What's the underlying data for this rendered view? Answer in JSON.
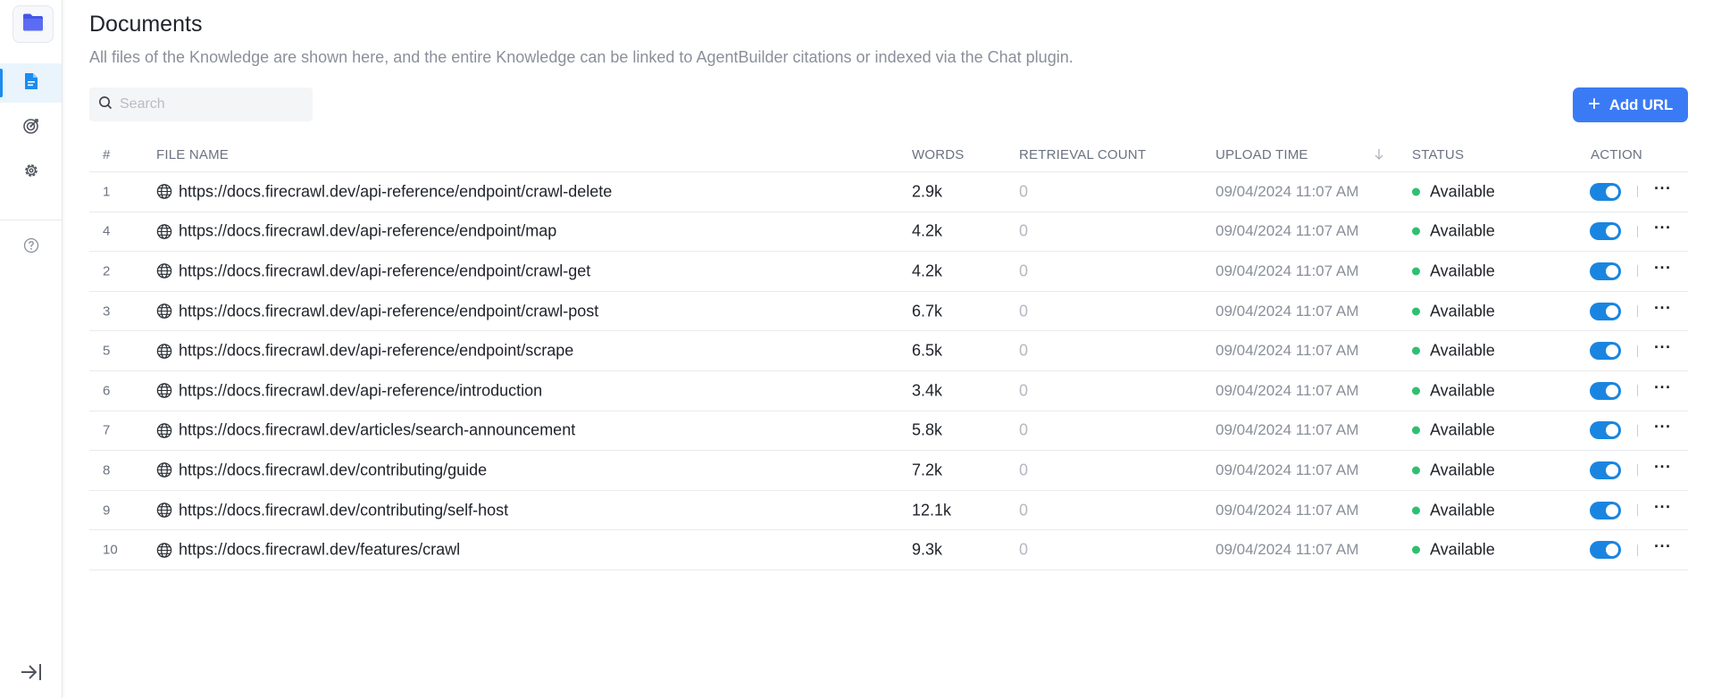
{
  "page": {
    "title": "Documents",
    "description": "All files of the Knowledge are shown here, and the entire Knowledge can be linked to AgentBuilder citations or indexed via the Chat plugin."
  },
  "search": {
    "placeholder": "Search"
  },
  "add_button": {
    "label": "Add URL"
  },
  "colors": {
    "accent": "#3a7bf5",
    "toggle_on": "#1a85e0",
    "status_available": "#2fbf71",
    "active_nav_bg": "#e9f4fd"
  },
  "sidebar": {
    "icons": [
      "folder-icon",
      "document-icon",
      "target-icon",
      "gear-icon",
      "help-icon",
      "collapse-icon"
    ]
  },
  "table": {
    "headers": {
      "num": "#",
      "file_name": "FILE NAME",
      "words": "WORDS",
      "retrieval_count": "RETRIEVAL COUNT",
      "upload_time": "UPLOAD TIME",
      "status": "STATUS",
      "action": "ACTION"
    },
    "rows": [
      {
        "num": "1",
        "file": "https://docs.firecrawl.dev/api-reference/endpoint/crawl-delete",
        "words": "2.9k",
        "retrieval": "0",
        "time": "09/04/2024 11:07 AM",
        "status": "Available",
        "enabled": true
      },
      {
        "num": "4",
        "file": "https://docs.firecrawl.dev/api-reference/endpoint/map",
        "words": "4.2k",
        "retrieval": "0",
        "time": "09/04/2024 11:07 AM",
        "status": "Available",
        "enabled": true
      },
      {
        "num": "2",
        "file": "https://docs.firecrawl.dev/api-reference/endpoint/crawl-get",
        "words": "4.2k",
        "retrieval": "0",
        "time": "09/04/2024 11:07 AM",
        "status": "Available",
        "enabled": true
      },
      {
        "num": "3",
        "file": "https://docs.firecrawl.dev/api-reference/endpoint/crawl-post",
        "words": "6.7k",
        "retrieval": "0",
        "time": "09/04/2024 11:07 AM",
        "status": "Available",
        "enabled": true
      },
      {
        "num": "5",
        "file": "https://docs.firecrawl.dev/api-reference/endpoint/scrape",
        "words": "6.5k",
        "retrieval": "0",
        "time": "09/04/2024 11:07 AM",
        "status": "Available",
        "enabled": true
      },
      {
        "num": "6",
        "file": "https://docs.firecrawl.dev/api-reference/introduction",
        "words": "3.4k",
        "retrieval": "0",
        "time": "09/04/2024 11:07 AM",
        "status": "Available",
        "enabled": true
      },
      {
        "num": "7",
        "file": "https://docs.firecrawl.dev/articles/search-announcement",
        "words": "5.8k",
        "retrieval": "0",
        "time": "09/04/2024 11:07 AM",
        "status": "Available",
        "enabled": true
      },
      {
        "num": "8",
        "file": "https://docs.firecrawl.dev/contributing/guide",
        "words": "7.2k",
        "retrieval": "0",
        "time": "09/04/2024 11:07 AM",
        "status": "Available",
        "enabled": true
      },
      {
        "num": "9",
        "file": "https://docs.firecrawl.dev/contributing/self-host",
        "words": "12.1k",
        "retrieval": "0",
        "time": "09/04/2024 11:07 AM",
        "status": "Available",
        "enabled": true
      },
      {
        "num": "10",
        "file": "https://docs.firecrawl.dev/features/crawl",
        "words": "9.3k",
        "retrieval": "0",
        "time": "09/04/2024 11:07 AM",
        "status": "Available",
        "enabled": true
      }
    ]
  }
}
